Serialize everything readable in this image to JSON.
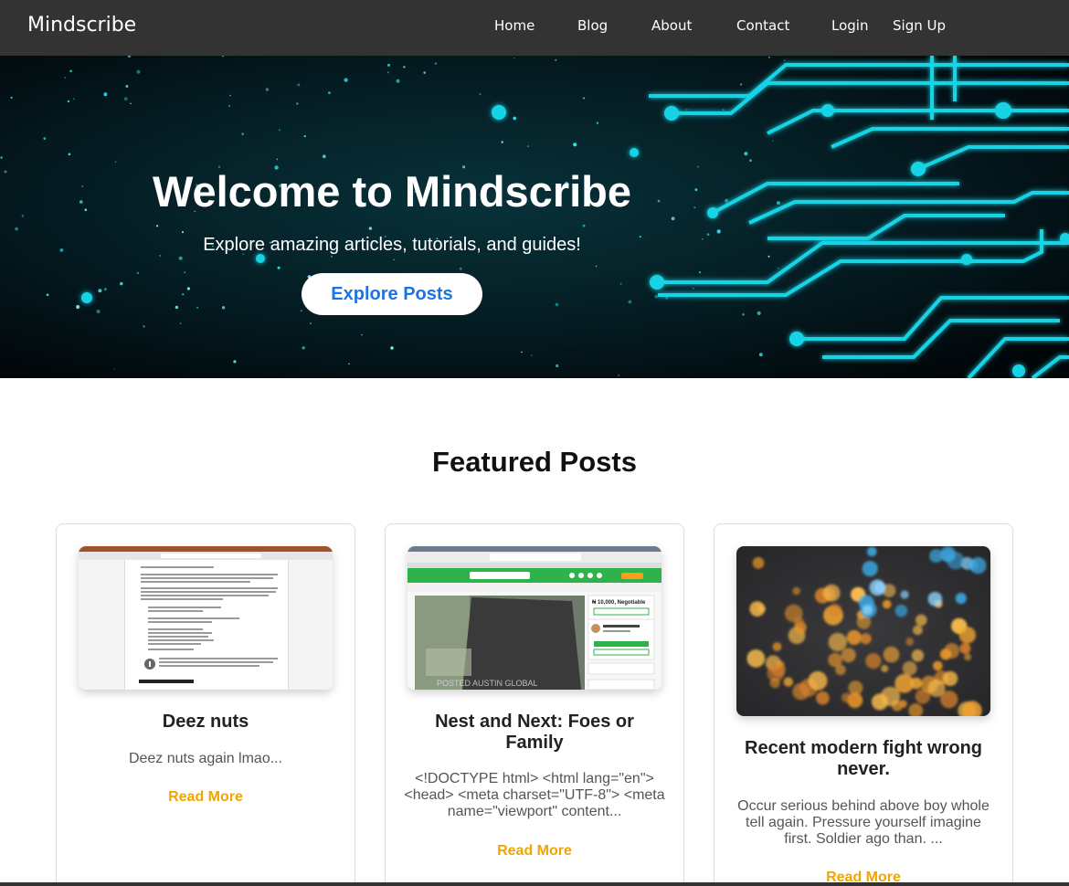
{
  "nav": {
    "brand": "Mindscribe",
    "links": [
      "Home",
      "Blog",
      "About",
      "Contact",
      "Login",
      "Sign Up"
    ]
  },
  "hero": {
    "title": "Welcome to Mindscribe",
    "subtitle": "Explore amazing articles, tutorials, and guides!",
    "button": "Explore Posts"
  },
  "featured": {
    "heading": "Featured Posts",
    "read_more": "Read More",
    "posts": [
      {
        "title": "Deez nuts",
        "excerpt": "Deez nuts again lmao...",
        "image": "document-screenshot"
      },
      {
        "title": "Nest and Next: Foes or Family",
        "excerpt": "<!DOCTYPE html> <html lang=\"en\"> <head> <meta charset=\"UTF-8\"> <meta name=\"viewport\" content...",
        "image": "marketplace-screenshot"
      },
      {
        "title": "Recent modern fight wrong never.",
        "excerpt": "Occur serious behind above boy whole tell again. Pressure yourself imagine first. Soldier ago than. ...",
        "image": "bokeh-lights-photo"
      }
    ],
    "thumb2": {
      "banner_text": "POSTED AUSTIN GLOBAL",
      "price": "₦ 10,000, Negotiable"
    }
  },
  "colors": {
    "navbar": "#333333",
    "accent_blue": "#1a73e8",
    "read_more": "#f0a500",
    "circuit": "#18d4e6",
    "market_green": "#2db34a"
  }
}
